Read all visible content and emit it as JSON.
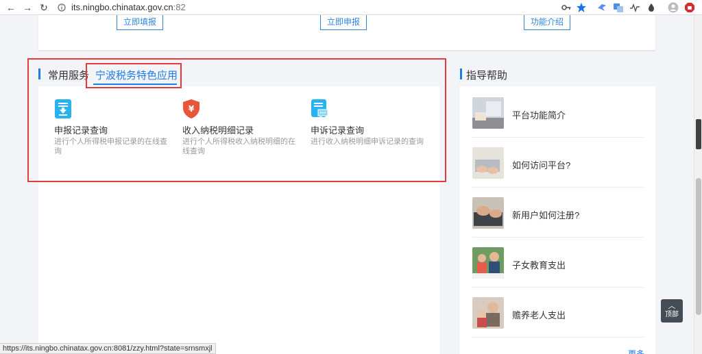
{
  "browser": {
    "url_host": "its.ningbo.chinatax.gov.cn",
    "url_port": ":82",
    "status_url": "https://its.ningbo.chinatax.gov.cn:8081/zzy.html?state=srnsmxjl"
  },
  "top_card": {
    "buttons": [
      "立即填报",
      "立即申报",
      "功能介绍"
    ]
  },
  "left_section": {
    "tab_common": "常用服务",
    "tab_special": "宁波税务特色应用",
    "services": [
      {
        "name": "申报记录查询",
        "desc": "进行个人所得税申报记录的在线查询",
        "icon": "document-download-icon"
      },
      {
        "name": "收入纳税明细记录",
        "desc": "进行个人所得税收入纳税明细的在线查询",
        "icon": "tax-shield-icon"
      },
      {
        "name": "申诉记录查询",
        "desc": "进行收入纳税明细申诉记录的查询",
        "icon": "document-chat-icon"
      }
    ]
  },
  "right_section": {
    "title": "指导帮助",
    "items": [
      {
        "label": "平台功能简介"
      },
      {
        "label": "如何访问平台?"
      },
      {
        "label": "新用户如何注册?"
      },
      {
        "label": "子女教育支出"
      },
      {
        "label": "赡养老人支出"
      }
    ],
    "more": "更多"
  },
  "back_to_top": {
    "label": "顶部",
    "arrow": "︿"
  },
  "colors": {
    "accent": "#1e7ce6",
    "highlight": "#e53838",
    "shield": "#e8563a",
    "doc": "#29b3ee"
  }
}
